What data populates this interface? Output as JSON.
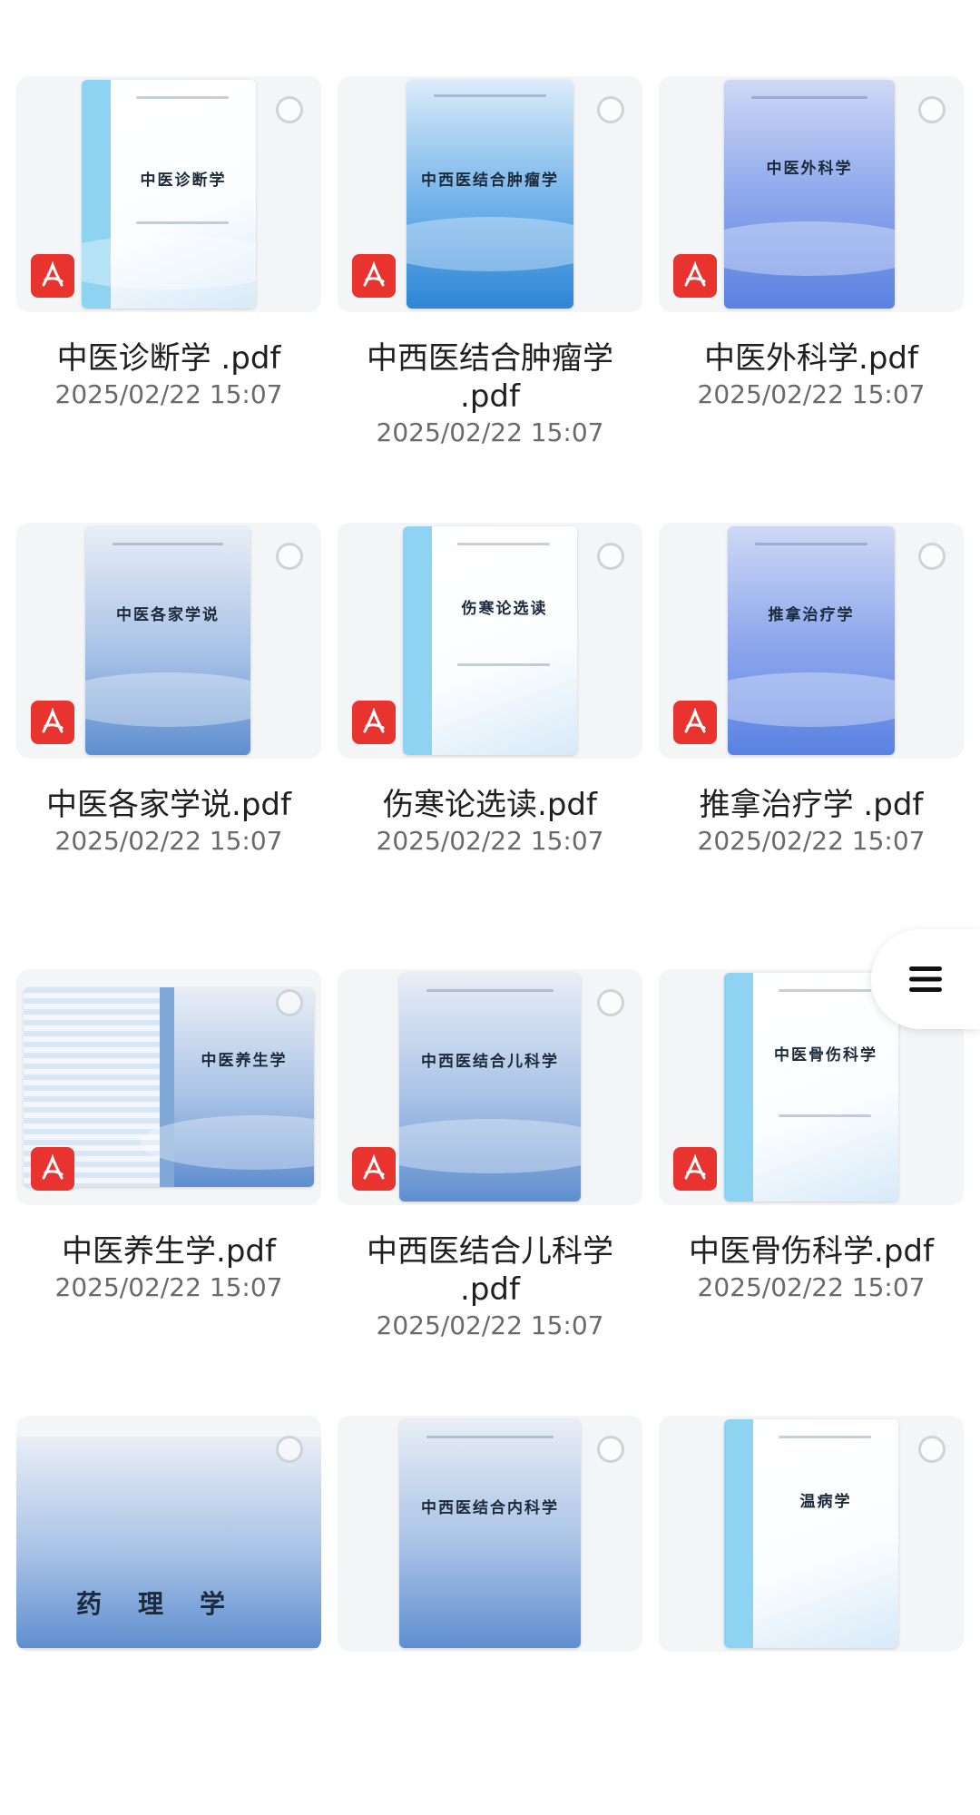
{
  "files": [
    {
      "title": "中医诊断学",
      "name": "中医诊断学  .pdf",
      "date": "2025/02/22 15:07"
    },
    {
      "title": "中西医结合肿瘤学",
      "name": "中西医结合肿瘤学\n.pdf",
      "date": "2025/02/22 15:07"
    },
    {
      "title": "中医外科学",
      "name": "中医外科学.pdf",
      "date": "2025/02/22 15:07"
    },
    {
      "title": "中医各家学说",
      "name": "中医各家学说.pdf",
      "date": "2025/02/22 15:07"
    },
    {
      "title": "伤寒论选读",
      "name": "伤寒论选读.pdf",
      "date": "2025/02/22 15:07"
    },
    {
      "title": "推拿治疗学",
      "name": "推拿治疗学 .pdf",
      "date": "2025/02/22 15:07"
    },
    {
      "title": "中医养生学",
      "name": "中医养生学.pdf",
      "date": "2025/02/22 15:07"
    },
    {
      "title": "中西医结合儿科学",
      "name": "中西医结合儿科学\n.pdf",
      "date": "2025/02/22 15:07"
    },
    {
      "title": "中医骨伤科学",
      "name": "中医骨伤科学.pdf",
      "date": "2025/02/22 15:07"
    },
    {
      "title": "药理学",
      "name": "",
      "date": ""
    },
    {
      "title": "中西医结合内科学",
      "name": "",
      "date": ""
    },
    {
      "title": "温病学",
      "name": "",
      "date": ""
    }
  ],
  "icons": {
    "file_type": "pdf-icon",
    "select": "select-circle-icon",
    "menu": "menu-icon"
  },
  "colors": {
    "pdf_badge": "#e8332f",
    "spine": "#8fd3f2"
  }
}
